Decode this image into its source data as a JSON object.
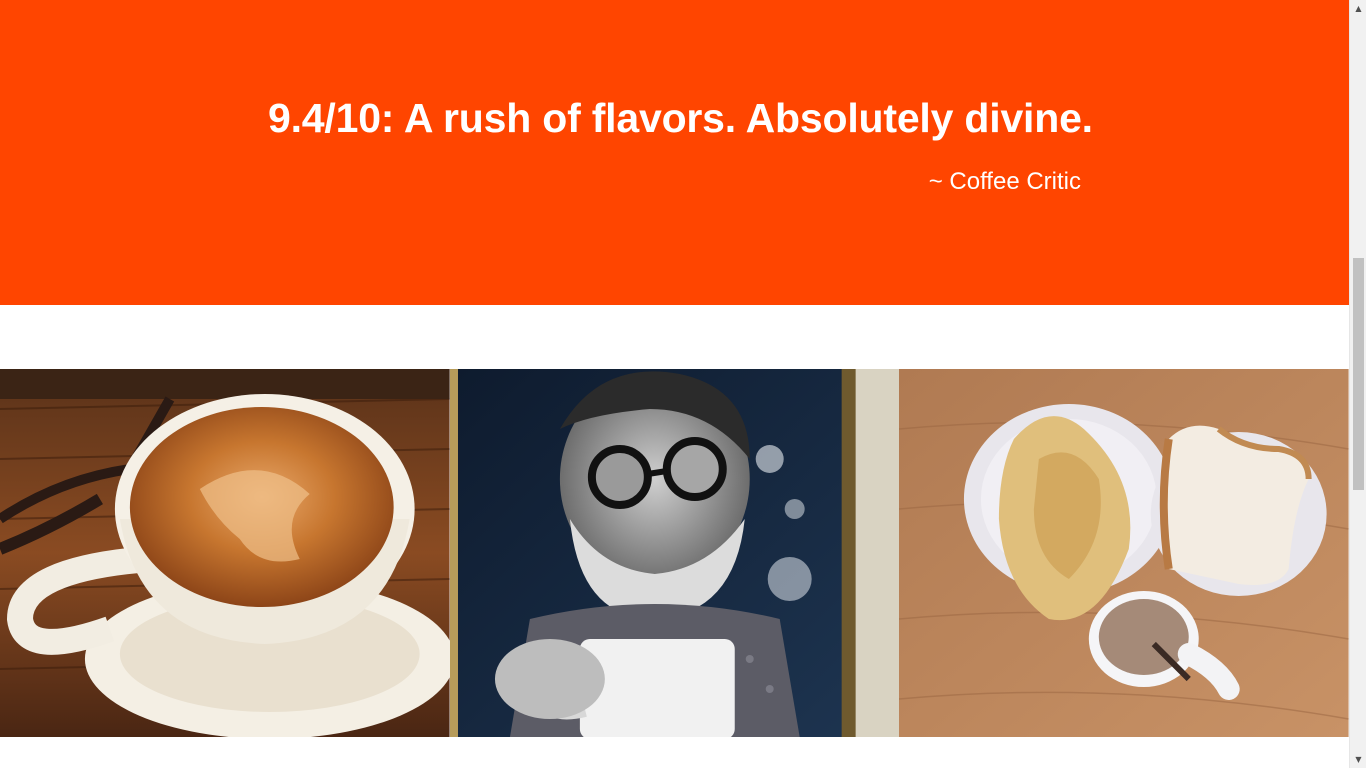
{
  "quote": {
    "text": "9.4/10: A rush of flavors. Absolutely divine.",
    "author": "~ Coffee Critic"
  },
  "colors": {
    "banner": "#ff4500",
    "text": "#ffffff"
  },
  "gallery": {
    "images": [
      {
        "name": "latte-art-cup-photo",
        "alt": "Cappuccino with latte art on wooden table"
      },
      {
        "name": "bearded-man-portrait-photo",
        "alt": "Black and white portrait of bearded man with round glasses holding a mug"
      },
      {
        "name": "breakfast-table-photo",
        "alt": "Omelette, toast and coffee on a wooden table"
      }
    ]
  },
  "scrollbar": {
    "up_icon": "triangle-up-icon",
    "down_icon": "triangle-down-icon"
  }
}
